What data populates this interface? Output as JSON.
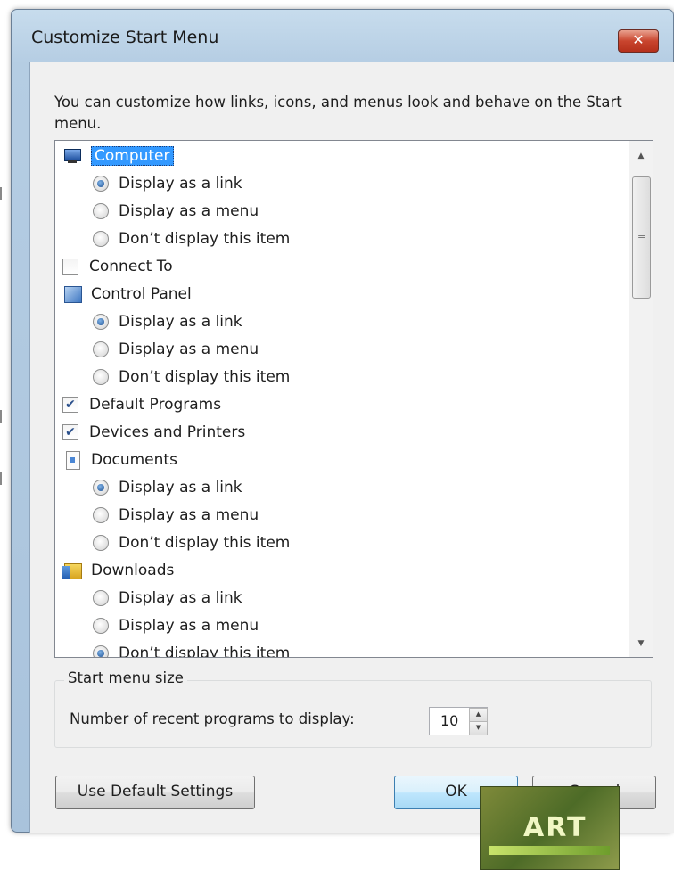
{
  "dialog": {
    "title": "Customize Start Menu",
    "close_glyph": "✕",
    "intro": "You can customize how links, icons, and menus look and behave on the Start menu."
  },
  "tree": {
    "items": [
      {
        "kind": "icon",
        "icon": "computer-icon",
        "label": "Computer",
        "selected": true
      },
      {
        "kind": "radio",
        "label": "Display as a link",
        "checked": true
      },
      {
        "kind": "radio",
        "label": "Display as a menu",
        "checked": false
      },
      {
        "kind": "radio",
        "label": "Don’t display this item",
        "checked": false
      },
      {
        "kind": "check",
        "label": "Connect To",
        "checked": false
      },
      {
        "kind": "icon",
        "icon": "control-panel-icon",
        "label": "Control Panel"
      },
      {
        "kind": "radio",
        "label": "Display as a link",
        "checked": true
      },
      {
        "kind": "radio",
        "label": "Display as a menu",
        "checked": false
      },
      {
        "kind": "radio",
        "label": "Don’t display this item",
        "checked": false
      },
      {
        "kind": "check",
        "label": "Default Programs",
        "checked": true
      },
      {
        "kind": "check",
        "label": "Devices and Printers",
        "checked": true
      },
      {
        "kind": "icon",
        "icon": "documents-icon",
        "label": "Documents"
      },
      {
        "kind": "radio",
        "label": "Display as a link",
        "checked": true
      },
      {
        "kind": "radio",
        "label": "Display as a menu",
        "checked": false
      },
      {
        "kind": "radio",
        "label": "Don’t display this item",
        "checked": false
      },
      {
        "kind": "icon",
        "icon": "downloads-icon",
        "label": "Downloads"
      },
      {
        "kind": "radio",
        "label": "Display as a link",
        "checked": false
      },
      {
        "kind": "radio",
        "label": "Display as a menu",
        "checked": false
      },
      {
        "kind": "radio",
        "label": "Don’t display this item",
        "checked": true
      }
    ]
  },
  "scrollbar": {
    "up_glyph": "▲",
    "down_glyph": "▼",
    "grip_glyph": "≡"
  },
  "menu_size": {
    "group_title": "Start menu size",
    "label": "Number of recent programs to display:",
    "value": "10",
    "up_glyph": "▲",
    "down_glyph": "▼"
  },
  "buttons": {
    "defaults": "Use Default Settings",
    "ok": "OK",
    "cancel": "Cancel"
  },
  "watermark": {
    "text": "ART"
  }
}
